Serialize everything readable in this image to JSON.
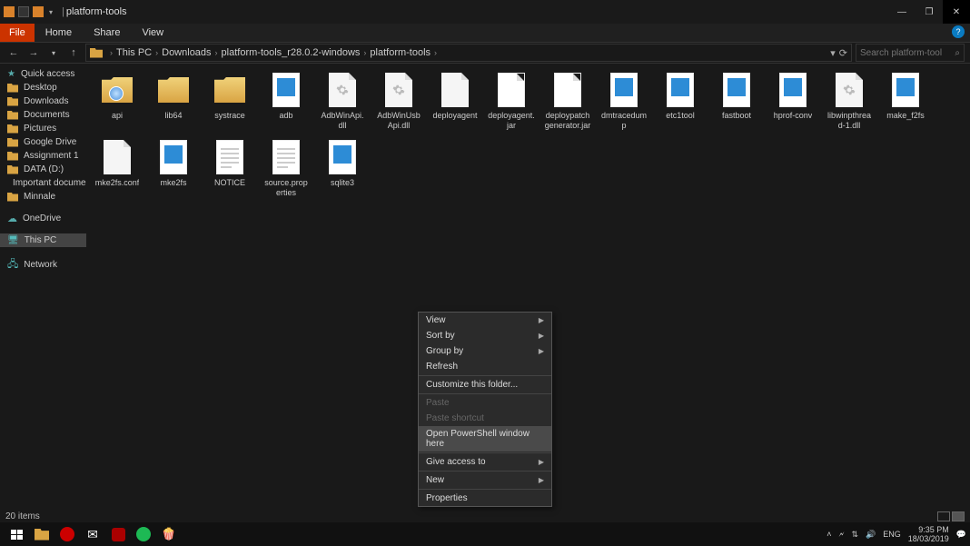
{
  "titlebar": {
    "title": "platform-tools"
  },
  "ribbon": {
    "file": "File",
    "tabs": [
      "Home",
      "Share",
      "View"
    ]
  },
  "breadcrumb": {
    "root": "This PC",
    "parts": [
      "Downloads",
      "platform-tools_r28.0.2-windows",
      "platform-tools"
    ]
  },
  "search": {
    "placeholder": "Search platform-tools"
  },
  "sidebar": {
    "quick_access": "Quick access",
    "items": [
      "Desktop",
      "Downloads",
      "Documents",
      "Pictures",
      "Google Drive",
      "Assignment 1",
      "DATA (D:)",
      "Important documen",
      "Minnale"
    ],
    "onedrive": "OneDrive",
    "thispc": "This PC",
    "network": "Network"
  },
  "files": [
    {
      "name": "api",
      "kind": "chm"
    },
    {
      "name": "lib64",
      "kind": "folder"
    },
    {
      "name": "systrace",
      "kind": "folder"
    },
    {
      "name": "adb",
      "kind": "bluedoc"
    },
    {
      "name": "AdbWinApi.dll",
      "kind": "gear"
    },
    {
      "name": "AdbWinUsbApi.dll",
      "kind": "gear"
    },
    {
      "name": "deployagent",
      "kind": "blank"
    },
    {
      "name": "deployagent.jar",
      "kind": "jar"
    },
    {
      "name": "deploypatchgenerator.jar",
      "kind": "jar"
    },
    {
      "name": "dmtracedump",
      "kind": "bluedoc"
    },
    {
      "name": "etc1tool",
      "kind": "bluedoc"
    },
    {
      "name": "fastboot",
      "kind": "bluedoc"
    },
    {
      "name": "hprof-conv",
      "kind": "bluedoc"
    },
    {
      "name": "libwinpthread-1.dll",
      "kind": "gear"
    },
    {
      "name": "make_f2fs",
      "kind": "bluedoc"
    },
    {
      "name": "mke2fs.conf",
      "kind": "blank"
    },
    {
      "name": "mke2fs",
      "kind": "bluedoc"
    },
    {
      "name": "NOTICE",
      "kind": "lines"
    },
    {
      "name": "source.properties",
      "kind": "lines"
    },
    {
      "name": "sqlite3",
      "kind": "bluedoc"
    }
  ],
  "context_menu": {
    "items": [
      {
        "label": "View",
        "sub": true
      },
      {
        "label": "Sort by",
        "sub": true
      },
      {
        "label": "Group by",
        "sub": true
      },
      {
        "label": "Refresh"
      },
      {
        "sep": true
      },
      {
        "label": "Customize this folder..."
      },
      {
        "sep": true
      },
      {
        "label": "Paste",
        "disabled": true
      },
      {
        "label": "Paste shortcut",
        "disabled": true
      },
      {
        "label": "Open PowerShell window here",
        "hovered": true
      },
      {
        "sep": true
      },
      {
        "label": "Give access to",
        "sub": true
      },
      {
        "sep": true
      },
      {
        "label": "New",
        "sub": true
      },
      {
        "sep": true
      },
      {
        "label": "Properties"
      }
    ]
  },
  "statusbar": {
    "count": "20 items"
  },
  "taskbar": {
    "tray": {
      "lang": "ENG",
      "time": "9:35 PM",
      "date": "18/03/2019"
    }
  }
}
